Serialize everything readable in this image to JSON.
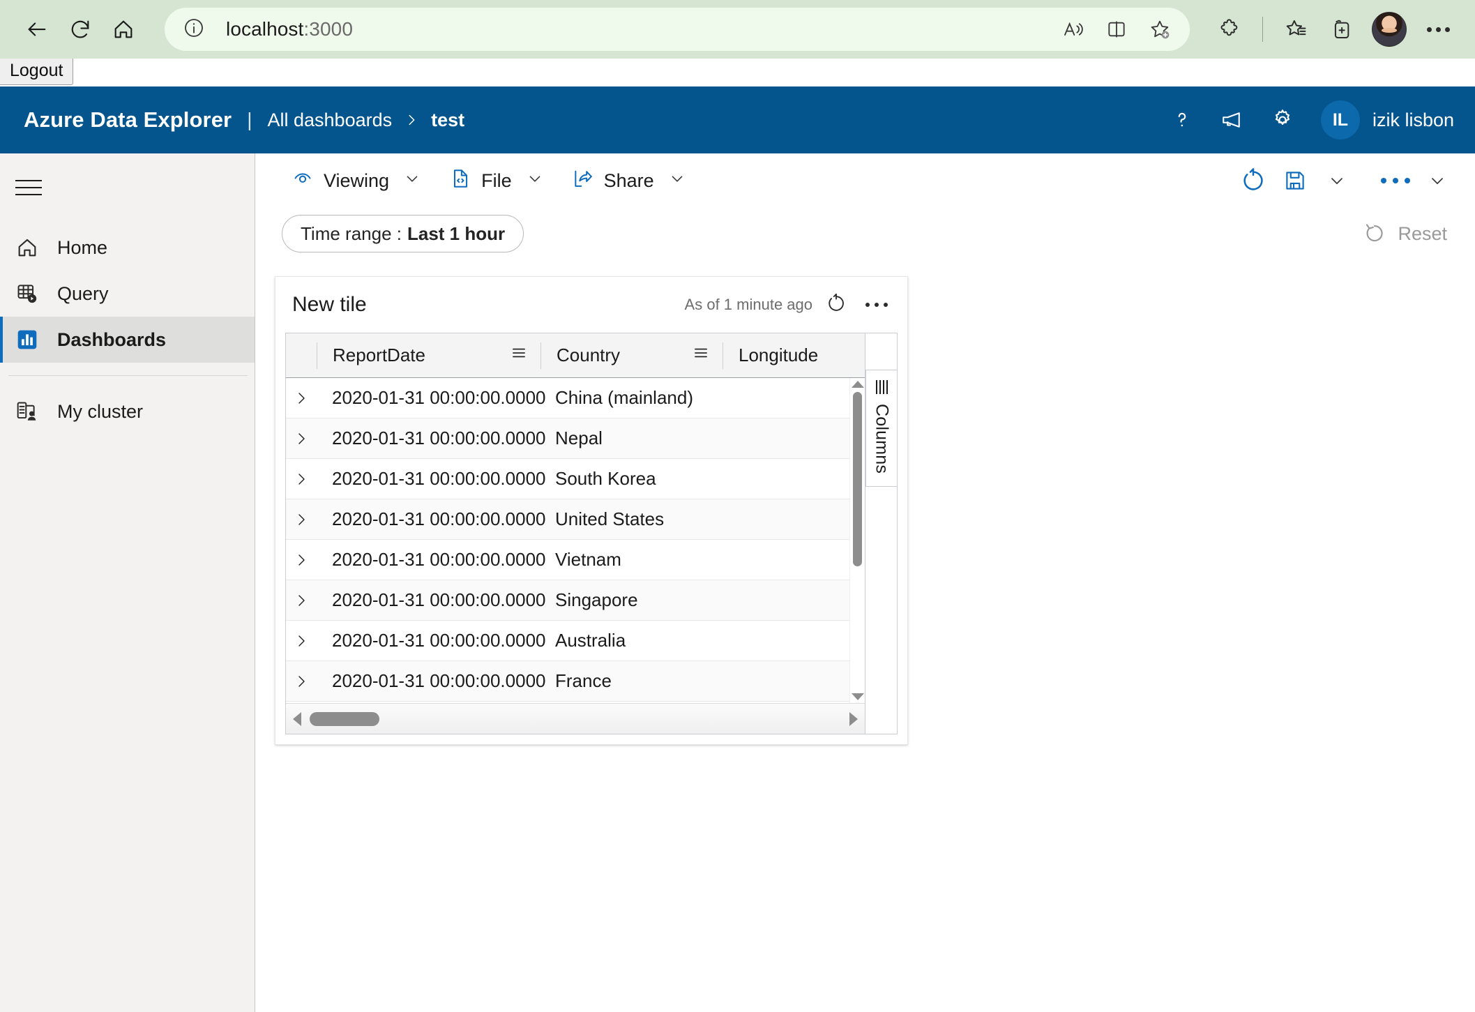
{
  "browser": {
    "back_label": "Back",
    "refresh_label": "Refresh",
    "home_label": "Home",
    "url_main": "localhost",
    "url_port": ":3000",
    "read_aloud_label": "Read aloud",
    "split_screen_label": "Split screen",
    "add_favorite_label": "Add this page to favorites",
    "extensions_label": "Extensions",
    "favorites_label": "Favorites",
    "collections_label": "Collections",
    "profile_label": "Profile",
    "settings_more_label": "Settings and more"
  },
  "page_overlay": {
    "logout_label": "Logout"
  },
  "adx_header": {
    "brand": "Azure Data Explorer",
    "separator": "|",
    "breadcrumb": [
      {
        "label": "All dashboards",
        "current": false
      },
      {
        "label": "test",
        "current": true
      }
    ],
    "help_label": "Help",
    "feedback_label": "Feedback",
    "settings_label": "Settings",
    "avatar_initials": "IL",
    "username": "izik lisbon"
  },
  "sidebar": {
    "menu_label": "Menu",
    "items": [
      {
        "label": "Home",
        "icon": "home-icon",
        "active": false
      },
      {
        "label": "Query",
        "icon": "query-icon",
        "active": false
      },
      {
        "label": "Dashboards",
        "icon": "dashboards-icon",
        "active": true
      },
      {
        "label": "My cluster",
        "icon": "cluster-icon",
        "active": false
      }
    ]
  },
  "command_bar": {
    "buttons": [
      {
        "label": "Viewing",
        "icon": "viewing-icon",
        "has_chevron": true
      },
      {
        "label": "File",
        "icon": "file-code-icon",
        "has_chevron": true
      },
      {
        "label": "Share",
        "icon": "share-icon",
        "has_chevron": true
      }
    ],
    "refresh_label": "Refresh",
    "save_label": "Save",
    "save_chevron_label": "Save options",
    "more_label": "More commands",
    "more_chevron_label": "More"
  },
  "filter_bar": {
    "time_range_prefix": "Time range :",
    "time_range_value": "Last 1 hour",
    "reset_label": "Reset"
  },
  "tile": {
    "title": "New tile",
    "as_of": "As of 1 minute ago",
    "refresh_label": "Refresh tile",
    "more_label": "Tile menu",
    "columns_panel_label": "Columns",
    "table": {
      "columns": [
        "ReportDate",
        "Country",
        "Longitude"
      ],
      "rows": [
        {
          "ReportDate": "2020-01-31 00:00:00.0000",
          "Country": "China (mainland)"
        },
        {
          "ReportDate": "2020-01-31 00:00:00.0000",
          "Country": "Nepal"
        },
        {
          "ReportDate": "2020-01-31 00:00:00.0000",
          "Country": "South Korea"
        },
        {
          "ReportDate": "2020-01-31 00:00:00.0000",
          "Country": "United States"
        },
        {
          "ReportDate": "2020-01-31 00:00:00.0000",
          "Country": "Vietnam"
        },
        {
          "ReportDate": "2020-01-31 00:00:00.0000",
          "Country": "Singapore"
        },
        {
          "ReportDate": "2020-01-31 00:00:00.0000",
          "Country": "Australia"
        },
        {
          "ReportDate": "2020-01-31 00:00:00.0000",
          "Country": "France"
        }
      ]
    }
  },
  "colors": {
    "header_blue": "#04548d",
    "accent_blue": "#0f6cbd",
    "browser_chrome_green": "#d5e5d2",
    "urlbar_green": "#effaec",
    "sidebar_gray": "#f3f2f1",
    "sidebar_active": "#dededd"
  }
}
